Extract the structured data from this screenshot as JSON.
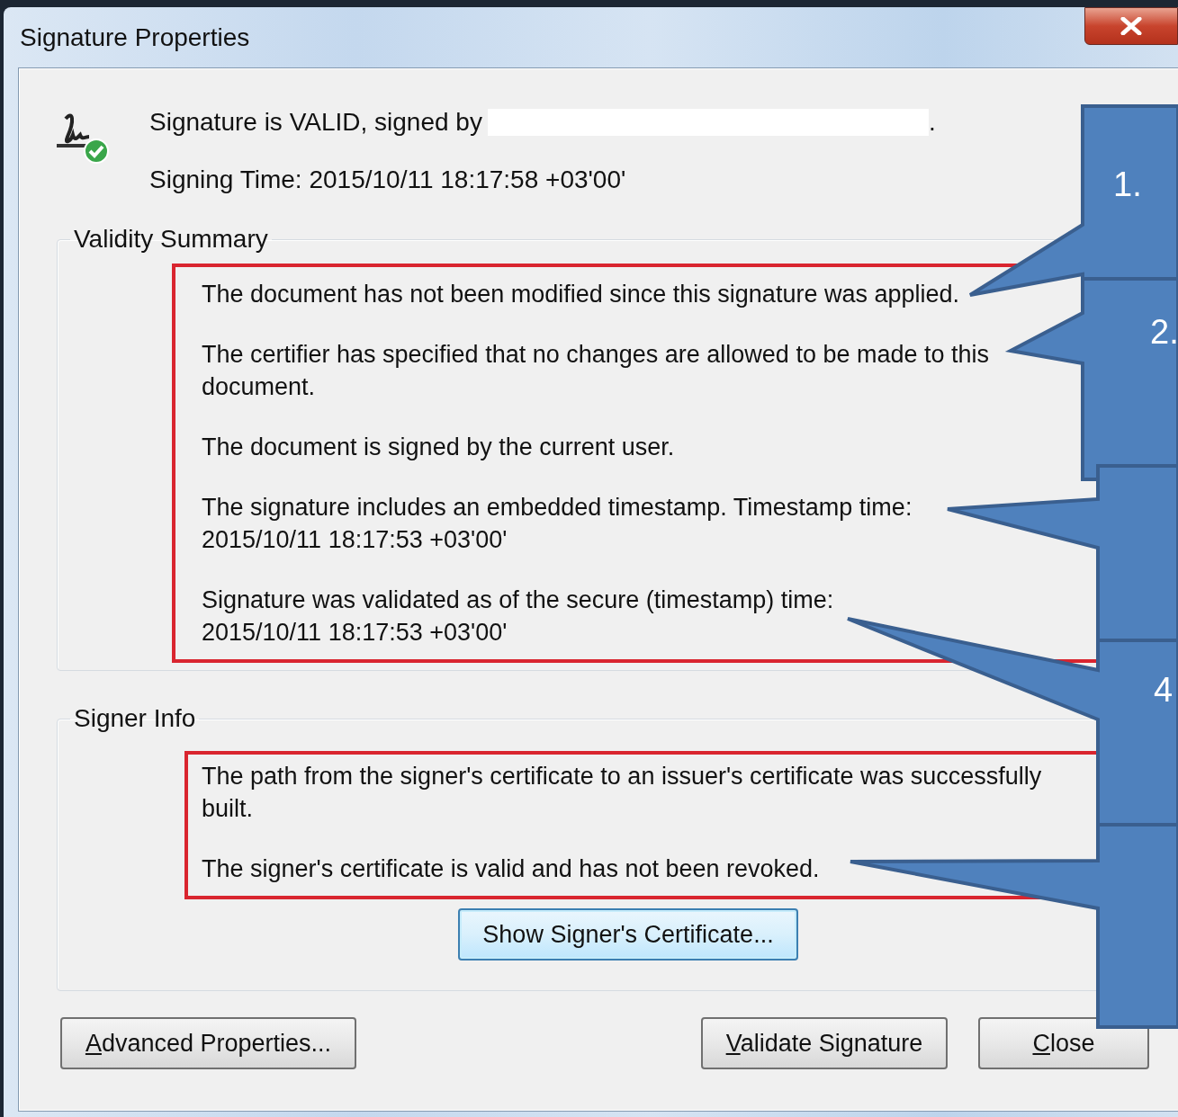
{
  "window": {
    "title": "Signature Properties"
  },
  "header": {
    "signer_before": "Signature is VALID, signed by",
    "signer_after": ".",
    "signing_time": "Signing Time:  2015/10/11 18:17:58 +03'00'"
  },
  "validity_summary": {
    "title": "Validity Summary",
    "messages": [
      "The document has not been modified since this signature was applied.",
      "The certifier has specified that no changes are allowed to be made to this\ndocument.",
      "The document is signed by the current user.",
      "The signature includes an embedded timestamp. Timestamp time:\n2015/10/11 18:17:53 +03'00'",
      "Signature was validated as of the secure (timestamp) time:\n2015/10/11 18:17:53 +03'00'"
    ]
  },
  "signer_info": {
    "title": "Signer Info",
    "messages": [
      "The path from the signer's certificate to an issuer's certificate was successfully\nbuilt.",
      "The signer's certificate is valid and has not been revoked."
    ],
    "certificate_button": "Show Signer's Certificate..."
  },
  "buttons": [
    {
      "mnemonic": "A",
      "rest": "dvanced Properties..."
    },
    {
      "mnemonic": "V",
      "rest": "alidate Signature"
    },
    {
      "mnemonic": "C",
      "rest": "lose"
    }
  ],
  "callouts": [
    {
      "kind": "numbered",
      "label": "1."
    },
    {
      "kind": "numbered",
      "label": "2."
    },
    {
      "kind": "plain"
    },
    {
      "kind": "numbered",
      "label": "4"
    },
    {
      "kind": "plain"
    }
  ]
}
